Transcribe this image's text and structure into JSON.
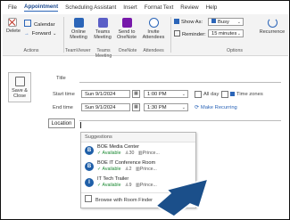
{
  "menu": [
    {
      "label": "File",
      "active": false
    },
    {
      "label": "Appointment",
      "active": true
    },
    {
      "label": "Scheduling Assistant",
      "active": false
    },
    {
      "label": "Insert",
      "active": false
    },
    {
      "label": "Format Text",
      "active": false
    },
    {
      "label": "Review",
      "active": false
    },
    {
      "label": "Help",
      "active": false
    }
  ],
  "ribbon": {
    "delete": "Delete",
    "calendar": "Calendar",
    "forward": "Forward",
    "actions": "Actions",
    "online_meeting_1": "Online",
    "online_meeting_2": "Meeting",
    "teams_meeting_1": "Teams",
    "teams_meeting_2": "Meeting",
    "onenote_1": "Send to",
    "onenote_2": "OneNote",
    "invite_1": "Invite",
    "invite_2": "Attendees",
    "g_teamviewer": "TeamViewer",
    "g_teams": "Teams Meeting",
    "g_onenote": "OneNote",
    "g_attendees": "Attendees",
    "show_as_label": "Show As:",
    "show_as_value": "Busy",
    "reminder_label": "Reminder:",
    "reminder_value": "15 minutes",
    "recurrence": "Recurrence",
    "g_options": "Options"
  },
  "form": {
    "save_close_1": "Save &",
    "save_close_2": "Close",
    "title_label": "Title",
    "start_label": "Start time",
    "end_label": "End time",
    "start_date": "Sun 9/1/2024",
    "start_time": "1:00 PM",
    "end_date": "Sun 9/1/2024",
    "end_time": "1:30 PM",
    "all_day": "All day",
    "time_zones": "Time zones",
    "make_recurring": "Make Recurring",
    "location_button": "Location"
  },
  "suggestions": {
    "header": "Suggestions",
    "rooms": [
      {
        "initial": "B",
        "name": "BOE Media Center",
        "status": "Available",
        "capacity": "30",
        "building": "Prince..."
      },
      {
        "initial": "B",
        "name": "BOE IT Conference Room",
        "status": "Available",
        "capacity": "2",
        "building": "Prince..."
      },
      {
        "initial": "I",
        "name": "IT Tech Trailer",
        "status": "Available",
        "capacity": "9",
        "building": "Prince..."
      }
    ],
    "browse": "Browse with Room Finder"
  },
  "colors": {
    "accent": "#2b65b8",
    "available": "#1c8a33",
    "arrow": "#1b4f8a",
    "room_badge": "#1f5fa8"
  }
}
